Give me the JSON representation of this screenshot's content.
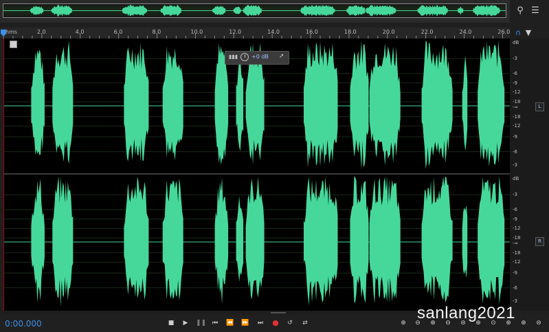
{
  "colors": {
    "waveform": "#46d89a",
    "background": "#000000",
    "timecode": "#3b8fea",
    "record": "#e03030",
    "playhead": "#3b8fea"
  },
  "ruler": {
    "unit": "hms",
    "ticks": [
      "2.0",
      "4.0",
      "6.0",
      "8.0",
      "10.0",
      "12.0",
      "14.0",
      "16.0",
      "18.0",
      "20.0",
      "22.0",
      "24.0",
      "26.0"
    ]
  },
  "view": {
    "start_seconds": 0,
    "end_seconds": 26.2
  },
  "hud": {
    "volume": "+0 dB"
  },
  "scale": {
    "unit": "dB",
    "labels": [
      "dB",
      "-3",
      "-6",
      "-9",
      "-12",
      "-18",
      "-∞",
      "-18",
      "-12",
      "-9",
      "-6",
      "-3"
    ]
  },
  "channels": [
    {
      "badge": "L"
    },
    {
      "badge": "R"
    }
  ],
  "audio_segments_seconds": [
    [
      1.4,
      2.1
    ],
    [
      2.5,
      3.6
    ],
    [
      6.2,
      7.5
    ],
    [
      8.2,
      9.3
    ],
    [
      10.9,
      11.6
    ],
    [
      12.0,
      12.4
    ],
    [
      12.5,
      13.5
    ],
    [
      15.5,
      17.3
    ],
    [
      17.9,
      18.9
    ],
    [
      18.9,
      20.5
    ],
    [
      21.6,
      23.2
    ],
    [
      23.7,
      24.0
    ],
    [
      24.5,
      25.9
    ]
  ],
  "transport": {
    "timecode": "0:00.000",
    "buttons": [
      "stop-icon",
      "play-icon",
      "pause-icon",
      "skip-start-icon",
      "rewind-icon",
      "fast-forward-icon",
      "skip-end-icon",
      "record-icon",
      "loop-icon",
      "skip-selection-icon"
    ]
  },
  "watermark": "sanlang2021"
}
